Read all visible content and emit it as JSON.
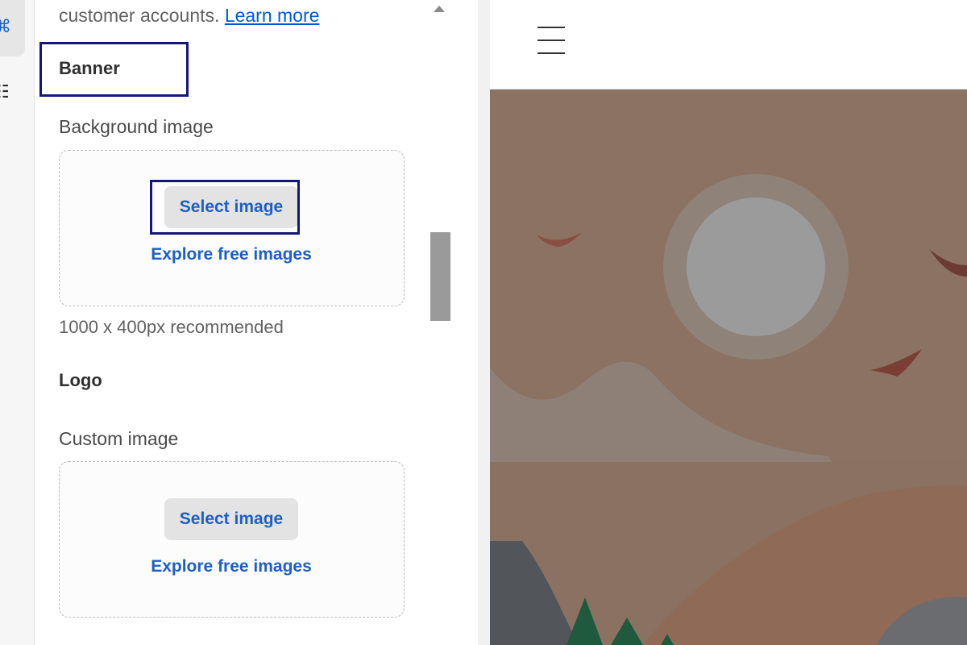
{
  "rail": {
    "items": [
      {
        "icon": "apps-icon",
        "active": true
      },
      {
        "icon": "sitemap-icon",
        "active": false
      }
    ]
  },
  "panel": {
    "intro_text": "customer accounts.",
    "intro_link": "Learn more",
    "banner": {
      "heading": "Banner",
      "background_label": "Background image",
      "select_label": "Select image",
      "explore_label": "Explore free images",
      "hint": "1000 x 400px recommended"
    },
    "logo": {
      "heading": "Logo",
      "custom_label": "Custom image",
      "select_label": "Select image",
      "explore_label": "Explore free images"
    }
  },
  "preview": {
    "menu_icon": "hamburger-icon",
    "banner_image": "landscape-illustration"
  },
  "colors": {
    "accent": "#1d5fc6",
    "focus_ring": "#14167a",
    "banner_sky": "#8b7262"
  }
}
